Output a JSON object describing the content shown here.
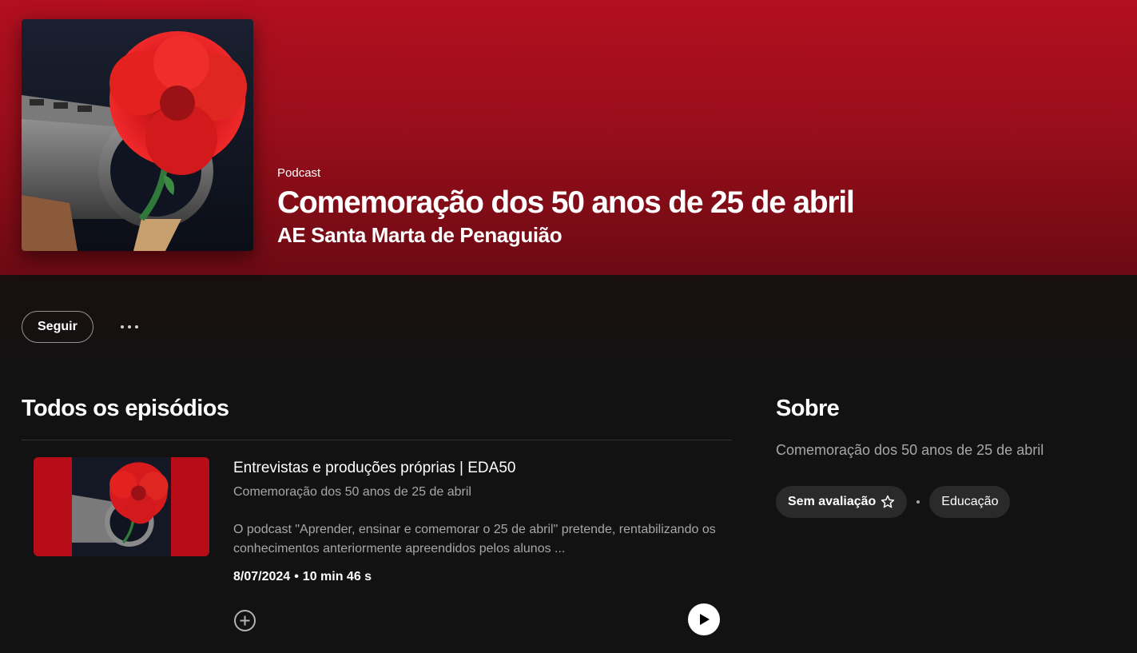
{
  "header": {
    "kind": "Podcast",
    "title": "Comemoração dos 50 anos de 25 de abril",
    "publisher": "AE Santa Marta de Penaguião",
    "colors": {
      "top": "#b30f1f",
      "bottom": "#6c0a13"
    }
  },
  "cover": {
    "icon": "carnation-rifle-artwork"
  },
  "actions": {
    "follow_label": "Seguir",
    "more_icon": "more-options-icon"
  },
  "episodes": {
    "heading": "Todos os episódios",
    "items": [
      {
        "title": "Entrevistas e produções próprias | EDA50",
        "show": "Comemoração dos 50 anos de 25 de abril",
        "description": "O podcast \"Aprender, ensinar e comemorar o 25 de abril\" pretende, rentabilizando os conhecimentos anteriormente apreendidos pelos alunos ...",
        "date": "8/07/2024",
        "separator": "•",
        "duration": "10 min 46 s"
      }
    ]
  },
  "about": {
    "heading": "Sobre",
    "text": "Comemoração dos 50 anos de 25 de abril",
    "rating_label": "Sem avaliação",
    "category": "Educação"
  }
}
